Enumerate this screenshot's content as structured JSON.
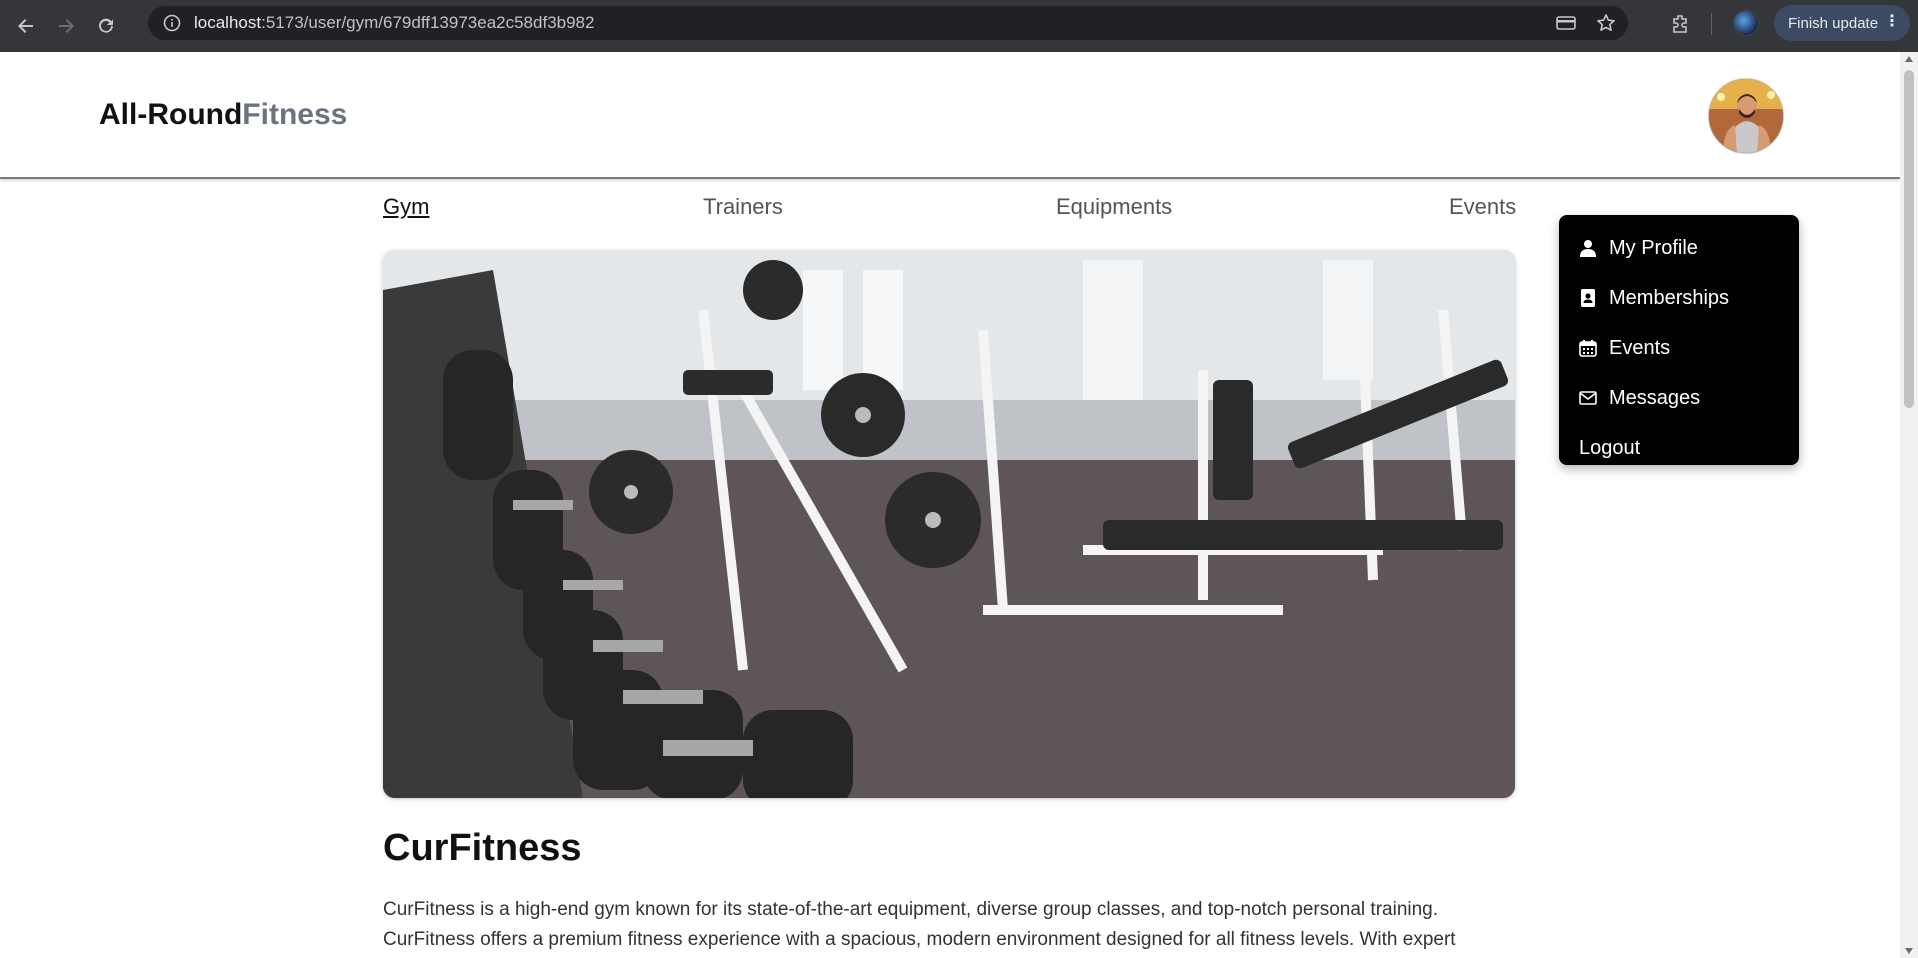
{
  "browser": {
    "url_host": "localhost",
    "url_rest": ":5173/user/gym/679dff13973ea2c58df3b982",
    "finish_update_label": "Finish update",
    "icons": [
      "back-icon",
      "forward-icon",
      "reload-icon",
      "site-info-icon",
      "card-icon",
      "star-icon",
      "extensions-icon",
      "profile-icon",
      "more-icon"
    ]
  },
  "header": {
    "brand_main": "All-Round",
    "brand_accent": "Fitness"
  },
  "tabs": [
    {
      "label": "Gym",
      "active": true
    },
    {
      "label": "Trainers",
      "active": false
    },
    {
      "label": "Equipments",
      "active": false
    },
    {
      "label": "Events",
      "active": false
    }
  ],
  "dropdown": {
    "items": [
      {
        "label": "My Profile",
        "icon": "user-icon"
      },
      {
        "label": "Memberships",
        "icon": "id-card-icon"
      },
      {
        "label": "Events",
        "icon": "calendar-icon"
      },
      {
        "label": "Messages",
        "icon": "envelope-icon"
      },
      {
        "label": "Logout",
        "icon": ""
      }
    ]
  },
  "gym": {
    "name": "CurFitness",
    "description_line1": "CurFitness is a high-end gym known for its state-of-the-art equipment, diverse group classes, and top-notch personal training.",
    "description_line2": "CurFitness offers a premium fitness experience with a spacious, modern environment designed for all fitness levels. With expert"
  },
  "colors": {
    "chrome_bg": "#35363a",
    "omnibox_bg": "#202124",
    "brand_accent": "#6b7280",
    "dropdown_bg": "#000000"
  }
}
